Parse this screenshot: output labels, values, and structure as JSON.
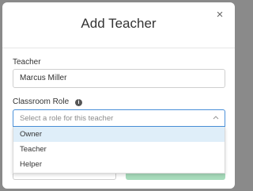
{
  "modal": {
    "title": "Add Teacher",
    "close_glyph": "×"
  },
  "teacher": {
    "label": "Teacher",
    "value": "Marcus Miller"
  },
  "classroom_role": {
    "label": "Classroom Role",
    "info_glyph": "i",
    "placeholder": "Select a role for this teacher",
    "options": [
      "Owner",
      "Teacher",
      "Helper"
    ],
    "highlighted_option": "Owner"
  },
  "colors": {
    "focus_border": "#4a90d9",
    "option_highlight": "#dfeef9",
    "primary_button": "#a8dcbc"
  },
  "icons": {
    "close": "close-icon",
    "info": "info-icon",
    "chevron": "chevron-up-icon"
  }
}
